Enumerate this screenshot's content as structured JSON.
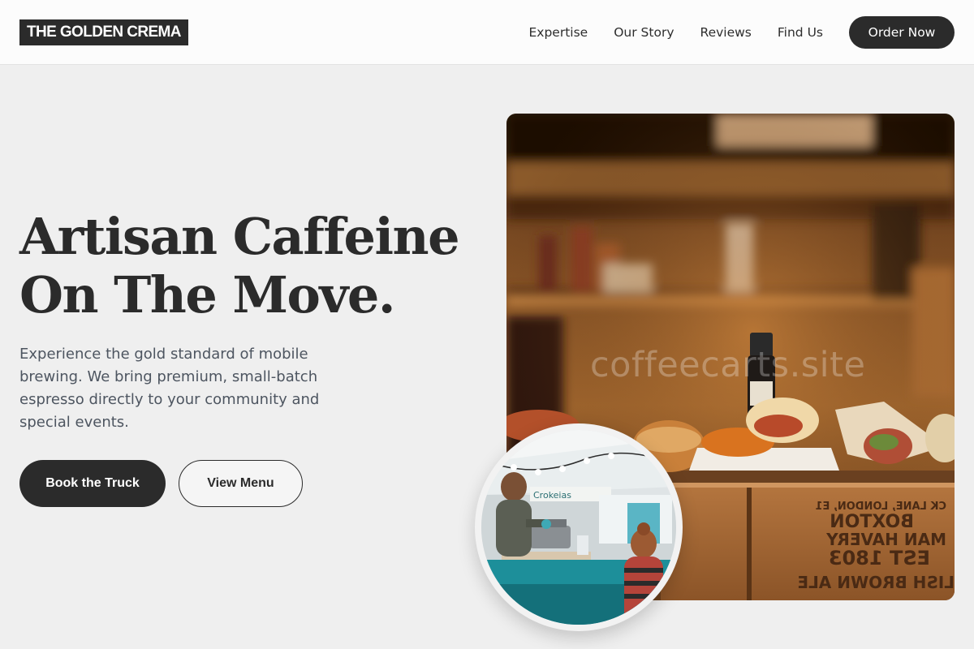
{
  "brand": {
    "name": "THE GOLDEN CREMA"
  },
  "nav": {
    "links": [
      "Expertise",
      "Our Story",
      "Reviews",
      "Find Us"
    ],
    "cta": "Order Now"
  },
  "hero": {
    "title_line1": "Artisan Caffeine",
    "title_line2": "On The Move.",
    "description": "Experience the gold standard of mobile brewing. We bring premium, small-batch espresso directly to your community and special events.",
    "primary_button": "Book the Truck",
    "secondary_button": "View Menu"
  },
  "images": {
    "watermark": "coffeecarts.site",
    "crate_text": [
      "CK LANE, LONDON, E1",
      "BOXTON",
      "MAN HAVERY",
      "EST 1803",
      "LISH BROWN ALE"
    ],
    "truck_sign": "Crokeias"
  },
  "colors": {
    "dark": "#2b2b2b",
    "background": "#efefef",
    "text_muted": "#4d5560",
    "header_bg": "#fcfcfc"
  }
}
